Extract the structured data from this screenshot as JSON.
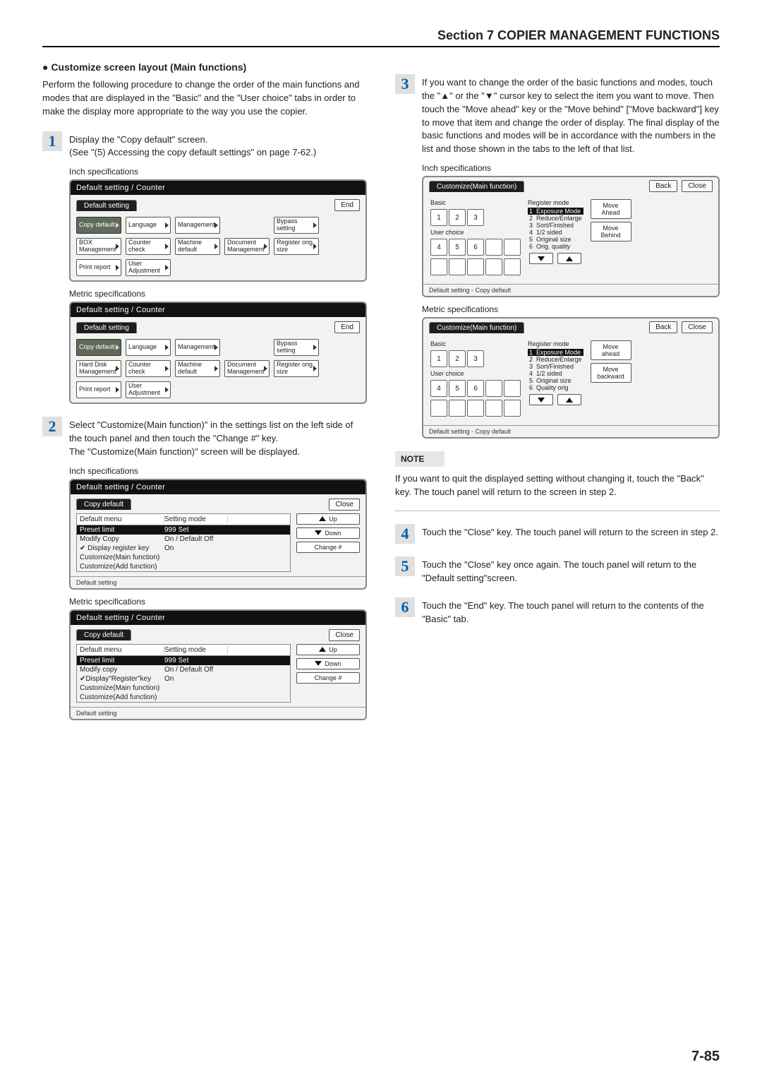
{
  "section_header": "Section 7  COPIER MANAGEMENT FUNCTIONS",
  "page_number": "7-85",
  "left": {
    "heading": "Customize screen layout (Main functions)",
    "intro": "Perform the following procedure to change the order of the main functions and modes that are displayed in the \"Basic\" and the \"User choice\" tabs in order to make the display more appropriate to the way you use the copier.",
    "step1": {
      "num": "1",
      "text": "Display the \"Copy default\" screen.\n(See \"(5) Accessing the copy default settings\" on page 7-62.)"
    },
    "inch_label": "Inch specifications",
    "metric_label": "Metric specifications",
    "panel_default": {
      "title": "Default setting / Counter",
      "tab_active": "Default setting",
      "end": "End",
      "btn_copy": "Copy default",
      "btn_lang": "Language",
      "btn_mgmt": "Management",
      "btn_bypass": "Bypass setting",
      "btn_box_inch": "BOX Management",
      "btn_box_metric": "Hard Disk Management",
      "btn_counter": "Counter check",
      "btn_machine": "Machine default",
      "btn_doc": "Document Management",
      "btn_reg": "Register orig. size",
      "btn_print": "Print report",
      "btn_user": "User Adjustment"
    },
    "step2": {
      "num": "2",
      "text": "Select \"Customize(Main function)\" in the settings list on the left side of the touch panel and then touch the \"Change #\" key.\nThe \"Customize(Main function)\" screen will be displayed."
    },
    "panel_list": {
      "title": "Default setting / Counter",
      "tab": "Copy default",
      "close": "Close",
      "h_menu": "Default menu",
      "h_mode": "Setting mode",
      "row1a": "Preset limit",
      "row1b": "999 Set",
      "row2a_inch": "Modify Copy",
      "row2a_metric": "Modify copy",
      "row2b": "On / Default Off",
      "row3a_inch": "Display register key",
      "row3a_metric": "Display\"Register\"key",
      "row3b": "On",
      "row4a": "Customize(Main function)",
      "row5a": "Customize(Add function)",
      "up": "Up",
      "down": "Down",
      "change": "Change #",
      "foot": "Default setting"
    }
  },
  "right": {
    "step3": {
      "num": "3",
      "text": "If you want to change the order of the basic functions and modes, touch the \"▲\" or the \"▼\" cursor key to select the item you want to move. Then touch the \"Move ahead\" key or the \"Move behind\" [\"Move backward\"] key to move that item and change the order of display. The final display of the basic functions and modes will be in accordance with the numbers in the list and those shown in the tabs to the left of that list."
    },
    "inch_label": "Inch specifications",
    "metric_label": "Metric specifications",
    "panel_cust": {
      "title": "Customize(Main function)",
      "back": "Back",
      "close": "Close",
      "basic": "Basic",
      "user": "User choice",
      "reg": "Register mode",
      "items": [
        "Exposure Mode",
        "Reduce/Enlarge",
        "Sort/Finished",
        "1/2 sided",
        "Original size",
        "Orig. quality"
      ],
      "items_metric": [
        "Exposure Mode",
        "Reduce/Enlarge",
        "Sort/Finished",
        "1/2 sided",
        "Original size",
        "Quality orig"
      ],
      "move_a_inch": "Move Ahead",
      "move_b_inch": "Move Behind",
      "move_a_metric": "Move ahead",
      "move_b_metric": "Move backward",
      "foot": "Default setting - Copy default"
    },
    "note_label": "NOTE",
    "note_text": "If you want to quit the displayed setting without changing it, touch the \"Back\" key. The touch panel will return to the screen in step 2.",
    "step4": {
      "num": "4",
      "text": "Touch the \"Close\" key. The touch panel will return to the screen in step 2."
    },
    "step5": {
      "num": "5",
      "text": "Touch the \"Close\" key once again. The touch panel will return to the \"Default setting\"screen."
    },
    "step6": {
      "num": "6",
      "text": "Touch the \"End\" key. The touch panel will return to the contents of the \"Basic\" tab."
    }
  }
}
